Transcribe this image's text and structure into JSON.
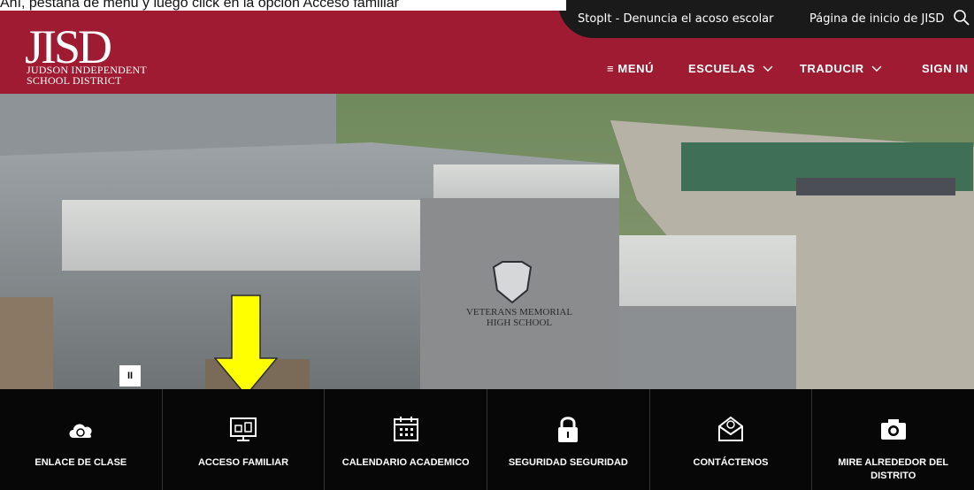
{
  "instruction_text": "Ahí, pestaña de menú y luego click en la opción Acceso familiar",
  "header": {
    "top_links": [
      "StopIt - Denuncia el acoso escolar",
      "Página de inicio de JISD"
    ],
    "logo": {
      "mark": "JISD",
      "line1": "JUDSON INDEPENDENT",
      "line2": "SCHOOL DISTRICT"
    },
    "nav": {
      "menu": "≡ MENÚ",
      "schools": "ESCUELAS",
      "translate": "TRADUCIR",
      "signin": "SIGN IN"
    }
  },
  "hero": {
    "sign_line1": "VETERANS MEMORIAL",
    "sign_line2": "HIGH SCHOOL",
    "pause_label": "II"
  },
  "tiles": [
    {
      "label": "ENLACE DE CLASE",
      "icon": "cloud-link-icon"
    },
    {
      "label": "ACCESO FAMILIAR",
      "icon": "computer-icon"
    },
    {
      "label": "CALENDARIO ACADEMICO",
      "icon": "calendar-icon"
    },
    {
      "label": "SEGURIDAD SEGURIDAD",
      "icon": "lock-icon"
    },
    {
      "label": "CONTÁCTENOS",
      "icon": "mail-icon"
    },
    {
      "label": "MIRE ALREDEDOR DEL DISTRITO",
      "icon": "camera-icon"
    }
  ],
  "colors": {
    "header_red": "#9e1b32",
    "topbar": "#1a1a1a",
    "footer": "#070707",
    "arrow": "#ffff00"
  }
}
